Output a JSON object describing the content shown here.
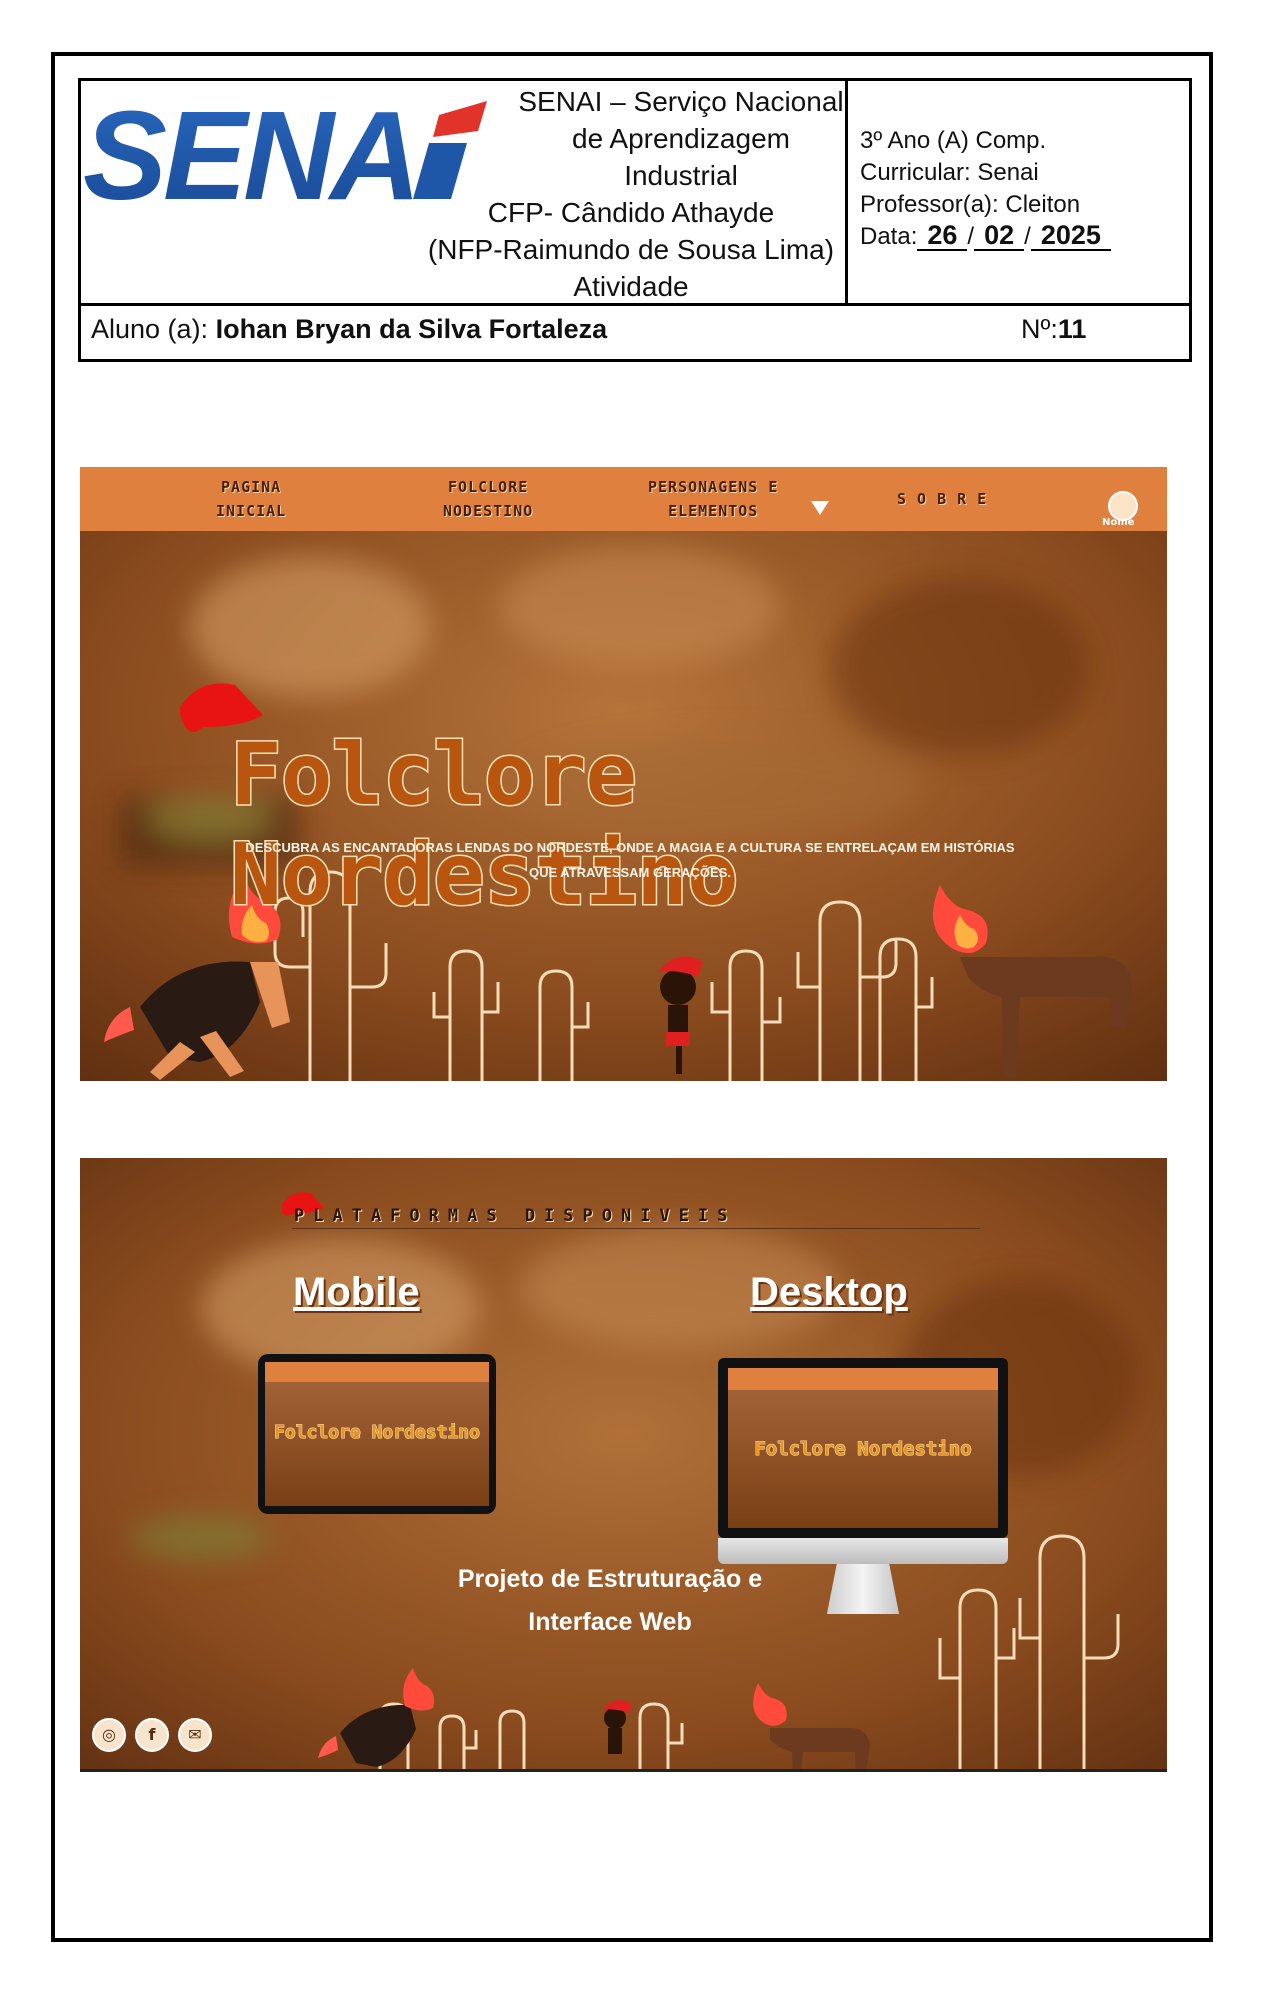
{
  "header": {
    "logo_text": "SENAi",
    "institution": [
      "SENAI – Serviço Nacional",
      "de Aprendizagem",
      "Industrial",
      "CFP- Cândido Athayde",
      "(NFP-Raimundo de Sousa Lima)",
      "Atividade"
    ],
    "class": "3º Ano (A) Comp.",
    "curricular": "Curricular: Senai",
    "teacher": "Professor(a): Cleiton",
    "date_label": "Data:",
    "date_day": "26",
    "date_month": "02",
    "date_year": "2025",
    "student_label": "Aluno (a):",
    "student_name": "Iohan Bryan da Silva Fortaleza",
    "number_label": "Nº:",
    "number_value": "11"
  },
  "screenshot1": {
    "nav": {
      "item1_line1": "PAGINA",
      "item1_line2": "INICIAL",
      "item2_line1": "FOLCLORE",
      "item2_line2": "NODESTINO",
      "item3_line1": "PERSONAGENS E",
      "item3_line2": "ELEMENTOS",
      "item4": "S O B R E",
      "profile_label": "Nome"
    },
    "title": "Folclore Nordestino",
    "subtitle_line1": "DESCUBRA AS ENCANTADORAS LENDAS DO NORDESTE, ONDE A MAGIA E A CULTURA SE ENTRELAÇAM EM HISTÓRIAS",
    "subtitle_line2": "QUE ATRAVESSAM GERAÇÕES."
  },
  "screenshot2": {
    "section_title": "PLATAFORMAS DISPONIVEIS",
    "mobile_label": "Mobile",
    "desktop_label": "Desktop",
    "preview_title": "Folclore Nordestino",
    "project_line1": "Projeto de Estruturação e",
    "project_line2": "Interface Web",
    "social_icons": [
      "instagram-icon",
      "facebook-icon",
      "mail-icon"
    ]
  },
  "colors": {
    "logo_blue": "#1f57a8",
    "logo_red": "#e2332a",
    "navbar": "#e0803f",
    "background_brown": "#7a3f16",
    "title_orange": "#b8560f"
  }
}
